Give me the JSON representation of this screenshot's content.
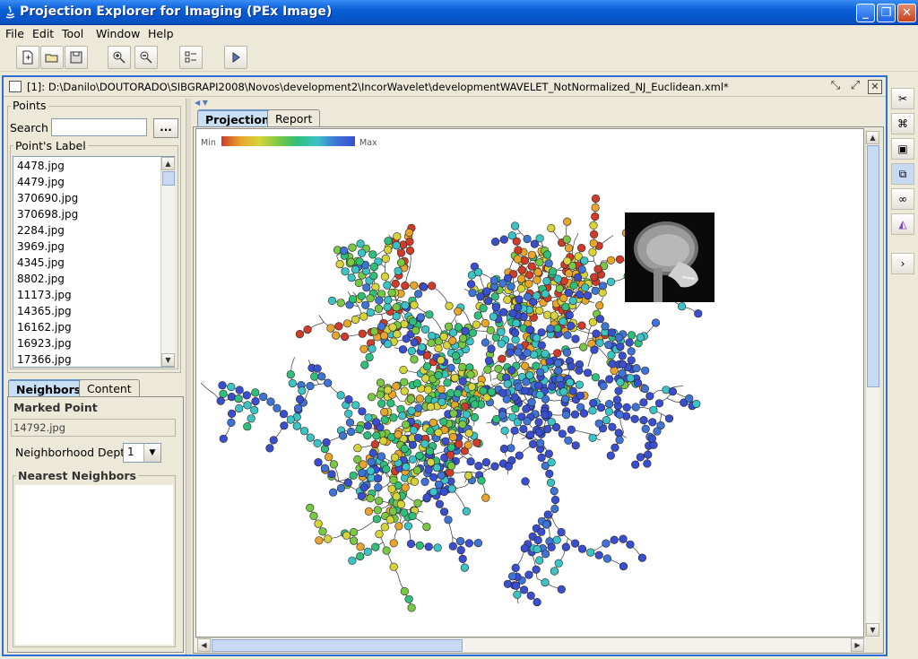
{
  "window": {
    "title": "Projection Explorer for Imaging (PEx Image)"
  },
  "menu": [
    "File",
    "Edit",
    "Tool",
    "Window",
    "Help"
  ],
  "toolbar": {
    "icons": [
      "new-file-icon",
      "open-folder-icon",
      "save-icon",
      "zoom-in-icon",
      "zoom-out-icon",
      "list-settings-icon",
      "play-icon"
    ]
  },
  "frame": {
    "title": "[1]: D:\\Danilo\\DOUTORADO\\SIBGRAPI2008\\Novos\\development2\\IncorWavelet\\developmentWAVELET_NotNormalized_NJ_Euclidean.xml*"
  },
  "points_panel": {
    "title": "Points",
    "search_label": "Search",
    "search_value": "",
    "search_button": "...",
    "label_group": "Point's Label",
    "items": [
      "4478.jpg",
      "4479.jpg",
      "370690.jpg",
      "370698.jpg",
      "2284.jpg",
      "3969.jpg",
      "4345.jpg",
      "8802.jpg",
      "11173.jpg",
      "14365.jpg",
      "16162.jpg",
      "16923.jpg",
      "17366.jpg"
    ]
  },
  "bottom_tabs": [
    "Neighbors",
    "Content"
  ],
  "neighbors": {
    "marked_label": "Marked Point",
    "marked_value": "14792.jpg",
    "depth_label": "Neighborhood Depth",
    "depth_value": "1",
    "nearest_label": "Nearest Neighbors"
  },
  "view_tabs": [
    "Projection",
    "Report"
  ],
  "legend": {
    "min": "Min",
    "max": "Max",
    "colors": [
      "#d03b2a",
      "#e8a52c",
      "#d6d43a",
      "#79c843",
      "#2fbf7a",
      "#3cc3c6",
      "#3f74d6",
      "#3a4fd0"
    ]
  },
  "right_toolbar": [
    "scissors-icon",
    "binoculars-icon",
    "select-box-icon",
    "copy-icon",
    "link-icon",
    "graph-icon",
    "expand-right-icon"
  ]
}
